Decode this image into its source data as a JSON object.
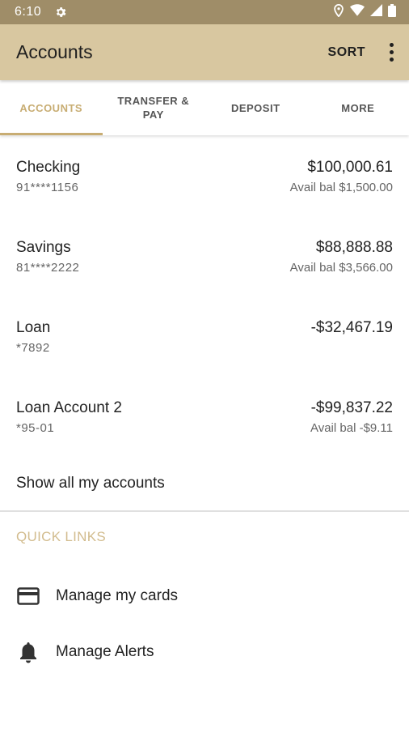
{
  "status_bar": {
    "time": "6:10"
  },
  "app_bar": {
    "title": "Accounts",
    "sort_label": "SORT"
  },
  "tabs": [
    {
      "label": "ACCOUNTS"
    },
    {
      "label": "TRANSFER & PAY"
    },
    {
      "label": "DEPOSIT"
    },
    {
      "label": "MORE"
    }
  ],
  "accounts": [
    {
      "name": "Checking",
      "number": "91****1156",
      "balance": "$100,000.61",
      "available": "Avail bal $1,500.00"
    },
    {
      "name": "Savings",
      "number": "81****2222",
      "balance": "$88,888.88",
      "available": "Avail bal $3,566.00"
    },
    {
      "name": "Loan",
      "number": "*7892",
      "balance": "-$32,467.19",
      "available": ""
    },
    {
      "name": "Loan Account 2",
      "number": "*95-01",
      "balance": "-$99,837.22",
      "available": "Avail bal -$9.11"
    }
  ],
  "show_all_label": "Show all my accounts",
  "quick_links": {
    "title": "QUICK LINKS",
    "items": [
      {
        "label": "Manage my cards",
        "icon": "credit-card-icon"
      },
      {
        "label": "Manage Alerts",
        "icon": "bell-icon"
      }
    ]
  },
  "colors": {
    "status_bar": "#9f8d68",
    "app_bar": "#d8c7a0",
    "accent": "#c8ad73",
    "quick_links_title": "#d2bc8e"
  }
}
